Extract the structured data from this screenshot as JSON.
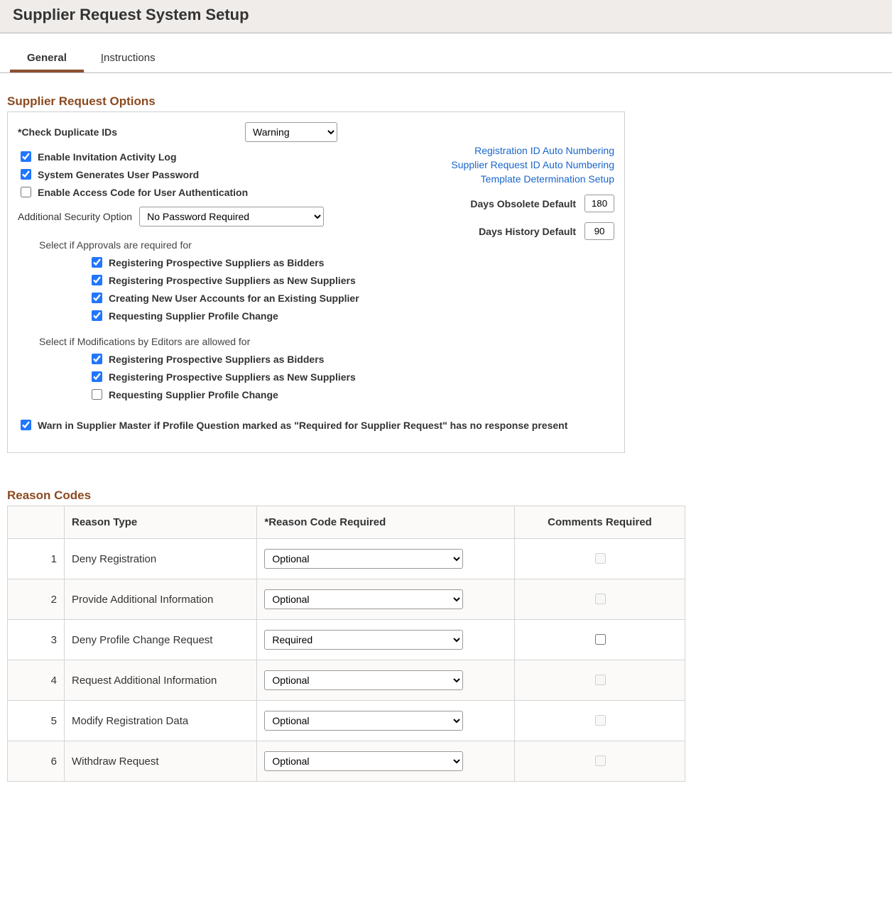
{
  "header": {
    "title": "Supplier Request System Setup"
  },
  "tabs": {
    "general": "General",
    "instructions": "Instructions",
    "ins_prefix": "I",
    "ins_suffix": "nstructions"
  },
  "section1_title": "Supplier Request Options",
  "check_dup_label": "*Check Duplicate IDs",
  "check_dup_value": "Warning",
  "enable_invite_log": {
    "label": "Enable Invitation Activity Log",
    "checked": true
  },
  "sys_gen_pwd": {
    "label": "System Generates User Password",
    "checked": true
  },
  "enable_access_code": {
    "label": "Enable Access Code for User Authentication",
    "checked": false
  },
  "add_sec_label": "Additional Security Option",
  "add_sec_value": "No Password Required",
  "links": {
    "reg_id": "Registration ID Auto Numbering",
    "sup_req_id": "Supplier Request ID Auto Numbering",
    "template": "Template Determination Setup"
  },
  "days_obsolete": {
    "label": "Days Obsolete Default",
    "value": "180"
  },
  "days_history": {
    "label": "Days History Default",
    "value": "90"
  },
  "approvals_header": "Select if Approvals are required for",
  "approvals": [
    {
      "label": "Registering Prospective Suppliers as Bidders",
      "checked": true
    },
    {
      "label": "Registering Prospective Suppliers as New Suppliers",
      "checked": true
    },
    {
      "label": "Creating New User Accounts for an Existing Supplier",
      "checked": true
    },
    {
      "label": "Requesting Supplier Profile Change",
      "checked": true
    }
  ],
  "mods_header": "Select if Modifications by Editors are allowed for",
  "mods": [
    {
      "label": "Registering Prospective Suppliers as Bidders",
      "checked": true
    },
    {
      "label": "Registering Prospective Suppliers as New Suppliers",
      "checked": true
    },
    {
      "label": "Requesting Supplier Profile Change",
      "checked": false
    }
  ],
  "warn_master": {
    "label": "Warn in Supplier Master if Profile Question marked as \"Required for Supplier Request\" has no response present",
    "checked": true
  },
  "section2_title": "Reason Codes",
  "reason_headers": {
    "type": "Reason Type",
    "code": "*Reason Code Required",
    "comments": "Comments Required"
  },
  "reason_rows": [
    {
      "n": "1",
      "type": "Deny Registration",
      "code": "Optional",
      "comments_checked": false,
      "comments_disabled": true
    },
    {
      "n": "2",
      "type": "Provide Additional Information",
      "code": "Optional",
      "comments_checked": false,
      "comments_disabled": true
    },
    {
      "n": "3",
      "type": "Deny Profile Change Request",
      "code": "Required",
      "comments_checked": false,
      "comments_disabled": false
    },
    {
      "n": "4",
      "type": "Request Additional Information",
      "code": "Optional",
      "comments_checked": false,
      "comments_disabled": true
    },
    {
      "n": "5",
      "type": "Modify Registration Data",
      "code": "Optional",
      "comments_checked": false,
      "comments_disabled": true
    },
    {
      "n": "6",
      "type": "Withdraw Request",
      "code": "Optional",
      "comments_checked": false,
      "comments_disabled": true
    }
  ]
}
